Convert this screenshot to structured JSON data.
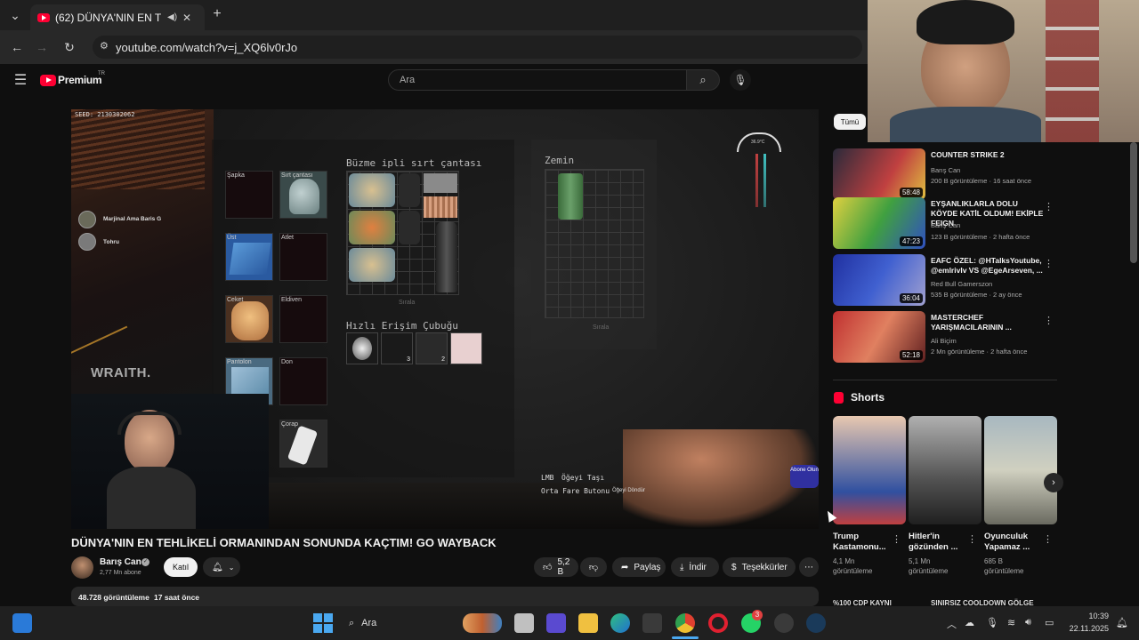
{
  "browser": {
    "tab_title": "(62) DÜNYA'NIN EN TEHLİKELİ ORMANINDAN",
    "new_tab": "+",
    "url": "youtube.com/watch?v=j_XQ6lv0rJo"
  },
  "yt_header": {
    "logo": "Premium",
    "logo_sup": "TR",
    "search_placeholder": "Ara"
  },
  "video_overlay": {
    "seed": "SEED: 2130302062",
    "players": [
      "Marjinal Ama Baris G",
      "Tohru"
    ],
    "bag_title": "Büzme ipli sırt çantası",
    "ground_title": "Zemin",
    "quickbar_title": "Hızlı Erişim Çubuğu",
    "sort_label": "Sırala",
    "sort_label2": "Sırala",
    "slots": {
      "hat": "Şapka",
      "backpack": "Sırt çantası",
      "top": "Üst",
      "armor": "Atlet",
      "jacket": "Ceket",
      "gloves": "Eldiven",
      "pants": "Pantolon",
      "underwear": "Don",
      "socks": "Çorap"
    },
    "quick_counts": [
      "3",
      "2"
    ],
    "hint_lmb": "LMB",
    "hint_lmb_action": "Öğeyi Taşı",
    "hint_mmb": "Orta Fare Butonu",
    "hint_mmb_action": "Öğeyi Döndür",
    "temp": "36.9°C",
    "watermark": "WRAITH.",
    "subscribe_badge": "Abone Olun"
  },
  "video": {
    "title": "DÜNYA'NIN EN TEHLİKELİ ORMANINDAN SONUNDA KAÇTIM! GO WAYBACK",
    "channel": "Barış Can",
    "subscribers": "2,77 Mn abone",
    "join": "Katıl",
    "likes": "5,2 B",
    "share": "Paylaş",
    "download": "İndir",
    "thanks": "Teşekkürler",
    "views": "48.728 görüntüleme",
    "age": "17 saat önce"
  },
  "sidebar": {
    "chip": "Tümü",
    "videos": [
      {
        "title": "COUNTER STRIKE 2",
        "channel": "Barış Can",
        "meta": "200 B görüntüleme · 16 saat önce",
        "duration": "58:48"
      },
      {
        "title": "EYŞANLIKLARLA DOLU KÖYDE KATİL OLDUM! EKİPLE FEIGN",
        "channel": "Barış Can",
        "meta": "123 B görüntüleme · 2 hafta önce",
        "duration": "47:23"
      },
      {
        "title": "EAFC ÖZEL: @HTalksYoutube, @emlrivlv VS @EgeArseven, ...",
        "channel": "Red Bull Gamerszon",
        "meta": "535 B görüntüleme · 2 ay önce",
        "duration": "36:04"
      },
      {
        "title": "MASTERCHEF YARIŞMACILARININ ...",
        "channel": "Ali Biçim",
        "meta": "2 Mn görüntüleme · 2 hafta önce",
        "duration": "52:18"
      }
    ],
    "shorts_title": "Shorts",
    "shorts": [
      {
        "title": "Trump Kastamonu...",
        "views": "4,1 Mn görüntüleme"
      },
      {
        "title": "Hitler'in gözünden ...",
        "views": "5,1 Mn görüntüleme"
      },
      {
        "title": "Oyunculuk Yapamaz ...",
        "views": "685 B görüntüleme"
      }
    ],
    "bottom_text_1": "%100 CDP KAYNI",
    "bottom_text_2": "SINIRSIZ COOLDOWN GÖLGE"
  },
  "taskbar": {
    "search": "Ara",
    "time": "10:39",
    "date": "22.11.2025",
    "opera_badge": "3"
  },
  "colors": {
    "youtube_red": "#ff0033",
    "bg": "#0f0f0f"
  }
}
